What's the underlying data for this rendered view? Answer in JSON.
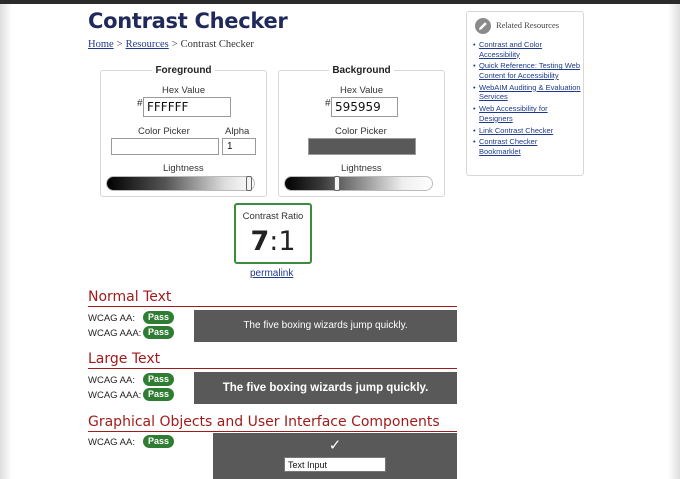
{
  "page": {
    "title": "Contrast Checker"
  },
  "breadcrumb": {
    "home": "Home",
    "sep1": ">",
    "resources": "Resources",
    "sep2": ">",
    "current": "Contrast Checker"
  },
  "foreground": {
    "title": "Foreground",
    "hex_label": "Hex Value",
    "hash": "#",
    "hex_value": "FFFFFF",
    "picker_label": "Color Picker",
    "alpha_label": "Alpha",
    "alpha_value": "1",
    "lightness_label": "Lightness",
    "color": "#ffffff",
    "lightness_level": 1.0
  },
  "background": {
    "title": "Background",
    "hex_label": "Hex Value",
    "hash": "#",
    "hex_value": "595959",
    "picker_label": "Color Picker",
    "lightness_label": "Lightness",
    "color": "#595959",
    "lightness_level": 0.35
  },
  "ratio": {
    "label": "Contrast Ratio",
    "main": "7",
    "rest": ":1",
    "permalink": "permalink"
  },
  "normal_text": {
    "heading": "Normal Text",
    "aa_label": "WCAG AA:",
    "aa_result": "Pass",
    "aaa_label": "WCAG AAA:",
    "aaa_result": "Pass",
    "sample": "The five boxing wizards jump quickly."
  },
  "large_text": {
    "heading": "Large Text",
    "aa_label": "WCAG AA:",
    "aa_result": "Pass",
    "aaa_label": "WCAG AAA:",
    "aaa_result": "Pass",
    "sample": "The five boxing wizards jump quickly."
  },
  "graphics": {
    "heading": "Graphical Objects and User Interface Components",
    "aa_label": "WCAG AA:",
    "aa_result": "Pass",
    "checkmark": "✓",
    "input_text": "Text Input"
  },
  "related": {
    "title": "Related Resources",
    "icon": "pencil-icon",
    "links": [
      "Contrast and Color Accessibility",
      "Quick Reference: Testing Web Content for Accessibility",
      "WebAIM Auditing & Evaluation Services",
      "Web Accessibility for Designers",
      "Link Contrast Checker",
      "Contrast Checker Bookmarklet"
    ]
  },
  "colors": {
    "title": "#1f2a5a",
    "section_red": "#a01c1c",
    "pass_green": "#2e7d32",
    "link_blue": "#1f3a8a"
  }
}
